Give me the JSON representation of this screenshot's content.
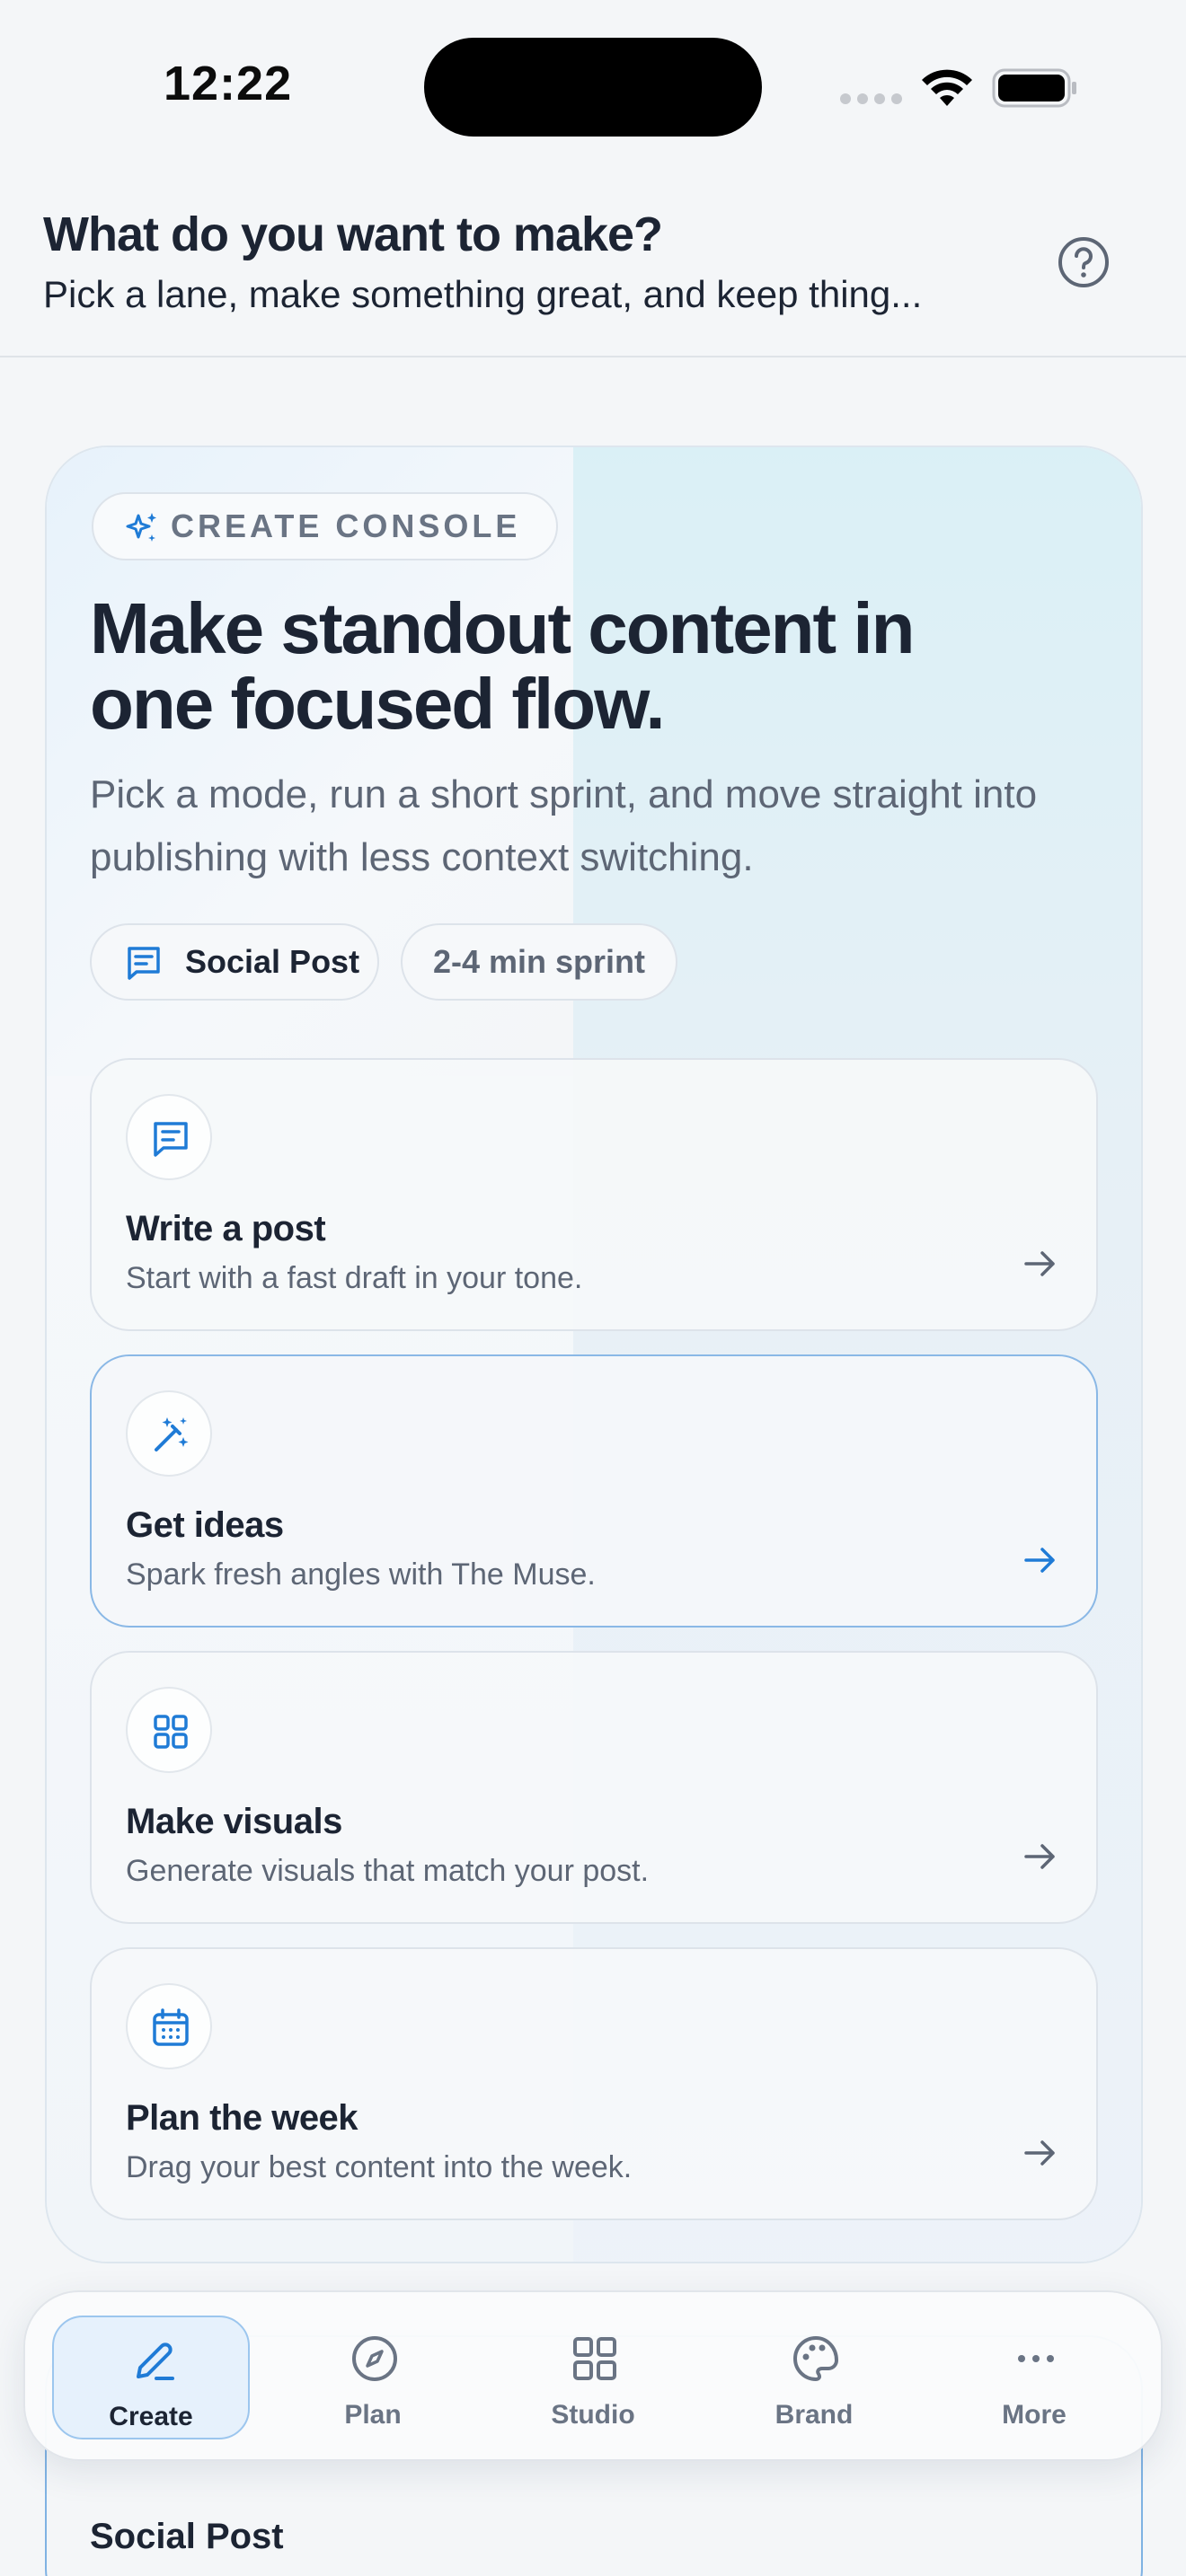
{
  "status_bar": {
    "time": "12:22"
  },
  "header": {
    "title": "What do you want to make?",
    "subtitle": "Pick a lane, make something great, and keep thing..."
  },
  "console": {
    "badge": "CREATE CONSOLE",
    "headline": "Make standout content in one focused flow.",
    "description": "Pick a mode, run a short sprint, and move straight into publishing with less context switching.",
    "chips": {
      "mode": "Social Post",
      "duration": "2-4 min sprint"
    },
    "actions": [
      {
        "title": "Write a post",
        "subtitle": "Start with a fast draft in your tone.",
        "icon": "message-square-icon"
      },
      {
        "title": "Get ideas",
        "subtitle": "Spark fresh angles with The Muse.",
        "icon": "magic-wand-icon"
      },
      {
        "title": "Make visuals",
        "subtitle": "Generate visuals that match your post.",
        "icon": "grid-icon"
      },
      {
        "title": "Plan the week",
        "subtitle": "Drag your best content into the week.",
        "icon": "calendar-icon"
      }
    ]
  },
  "peek_card": {
    "title": "Social Post"
  },
  "tabbar": {
    "tabs": [
      {
        "label": "Create",
        "icon": "pencil-icon",
        "active": true
      },
      {
        "label": "Plan",
        "icon": "compass-icon"
      },
      {
        "label": "Studio",
        "icon": "grid-icon"
      },
      {
        "label": "Brand",
        "icon": "palette-icon"
      },
      {
        "label": "More",
        "icon": "more-icon"
      }
    ]
  },
  "colors": {
    "accent": "#1f7bd6",
    "text": "#1c2433",
    "muted": "#5d6675"
  }
}
